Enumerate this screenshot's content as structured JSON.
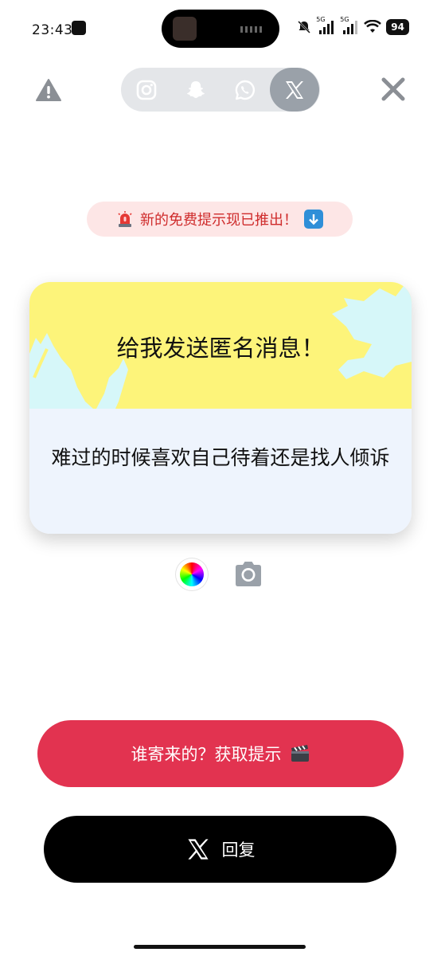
{
  "status": {
    "time": "23:43",
    "network_1": "5G",
    "network_2": "5G",
    "battery": "94"
  },
  "header": {
    "tabs": [
      {
        "icon": "instagram-icon",
        "active": false
      },
      {
        "icon": "snapchat-icon",
        "active": false
      },
      {
        "icon": "whatsapp-icon",
        "active": false
      },
      {
        "icon": "x-icon",
        "active": true
      }
    ]
  },
  "promo": {
    "text": "新的免费提示现已推出！"
  },
  "card": {
    "title": "给我发送匿名消息！",
    "question": "难过的时候喜欢自己待着还是找人倾诉"
  },
  "actions": {
    "hint_label": "谁寄来的？获取提示",
    "reply_label": "回复"
  },
  "colors": {
    "accent": "#e23350",
    "card_top": "#fdf47a",
    "card_bottom": "#eef4fd",
    "reply_bg": "#000000"
  }
}
